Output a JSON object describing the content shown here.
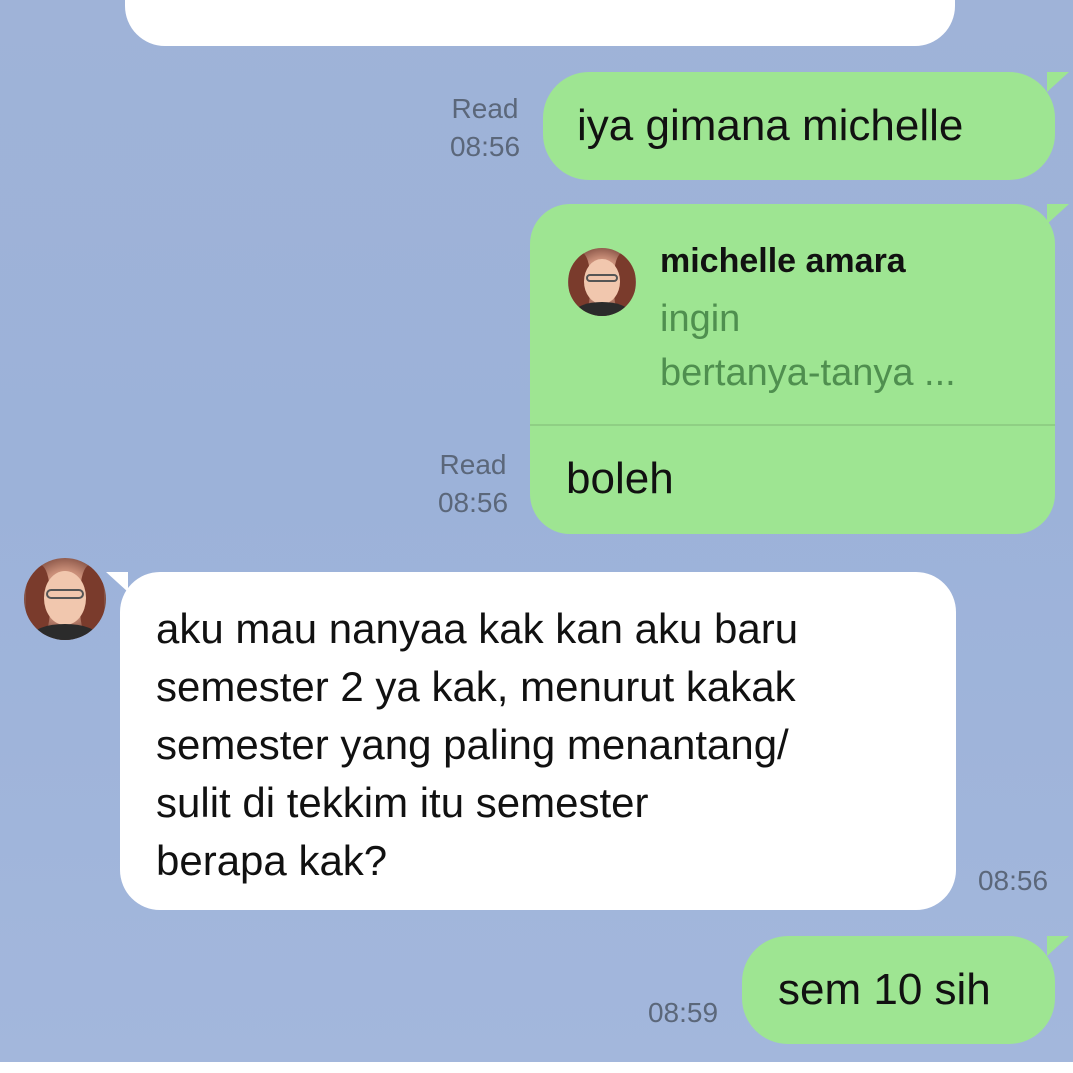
{
  "messages": [
    {
      "id": "m1",
      "side": "right",
      "status": "Read",
      "time": "08:56",
      "text": "iya gimana michelle"
    },
    {
      "id": "m2",
      "side": "right",
      "status": "Read",
      "time": "08:56",
      "reply_to": {
        "sender": "michelle amara",
        "preview_line1": "ingin",
        "preview_line2": "bertanya-tanya ..."
      },
      "text": "boleh"
    },
    {
      "id": "m3",
      "side": "left",
      "time": "08:56",
      "lines": [
        "aku mau nanyaa kak kan aku baru",
        "semester 2 ya kak, menurut kakak",
        "semester yang paling menantang/",
        "sulit di tekkim itu semester",
        "berapa kak?"
      ]
    },
    {
      "id": "m4",
      "side": "right",
      "time": "08:59",
      "text": "sem 10 sih"
    }
  ],
  "colors": {
    "background": "#9fb3d8",
    "outgoing_bubble": "#9ee592",
    "incoming_bubble": "#ffffff",
    "meta_text": "#5b677a",
    "reply_preview_text": "#4f8f4f"
  },
  "icons": {
    "contact_avatar": "avatar-photo"
  }
}
